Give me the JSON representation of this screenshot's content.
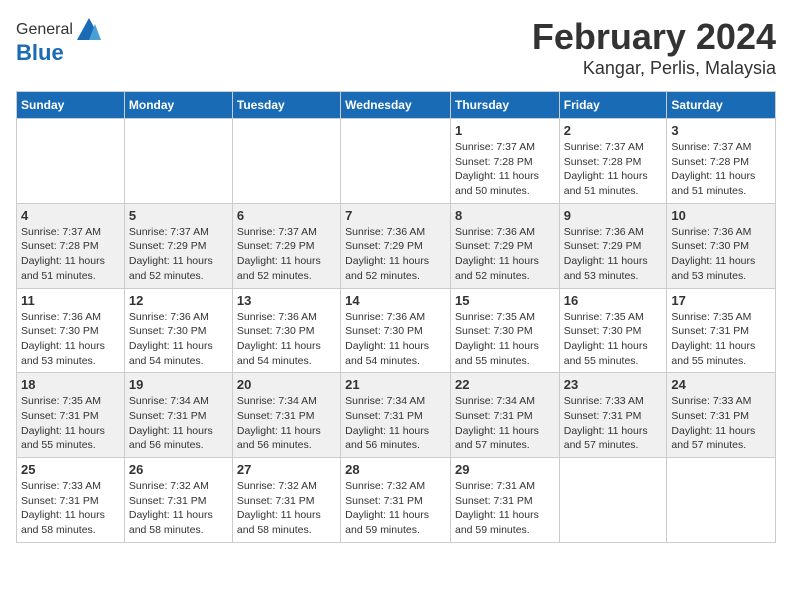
{
  "header": {
    "logo_general": "General",
    "logo_blue": "Blue",
    "month_title": "February 2024",
    "location": "Kangar, Perlis, Malaysia"
  },
  "weekdays": [
    "Sunday",
    "Monday",
    "Tuesday",
    "Wednesday",
    "Thursday",
    "Friday",
    "Saturday"
  ],
  "weeks": [
    [
      {
        "day": "",
        "info": ""
      },
      {
        "day": "",
        "info": ""
      },
      {
        "day": "",
        "info": ""
      },
      {
        "day": "",
        "info": ""
      },
      {
        "day": "1",
        "info": "Sunrise: 7:37 AM\nSunset: 7:28 PM\nDaylight: 11 hours\nand 50 minutes."
      },
      {
        "day": "2",
        "info": "Sunrise: 7:37 AM\nSunset: 7:28 PM\nDaylight: 11 hours\nand 51 minutes."
      },
      {
        "day": "3",
        "info": "Sunrise: 7:37 AM\nSunset: 7:28 PM\nDaylight: 11 hours\nand 51 minutes."
      }
    ],
    [
      {
        "day": "4",
        "info": "Sunrise: 7:37 AM\nSunset: 7:28 PM\nDaylight: 11 hours\nand 51 minutes."
      },
      {
        "day": "5",
        "info": "Sunrise: 7:37 AM\nSunset: 7:29 PM\nDaylight: 11 hours\nand 52 minutes."
      },
      {
        "day": "6",
        "info": "Sunrise: 7:37 AM\nSunset: 7:29 PM\nDaylight: 11 hours\nand 52 minutes."
      },
      {
        "day": "7",
        "info": "Sunrise: 7:36 AM\nSunset: 7:29 PM\nDaylight: 11 hours\nand 52 minutes."
      },
      {
        "day": "8",
        "info": "Sunrise: 7:36 AM\nSunset: 7:29 PM\nDaylight: 11 hours\nand 52 minutes."
      },
      {
        "day": "9",
        "info": "Sunrise: 7:36 AM\nSunset: 7:29 PM\nDaylight: 11 hours\nand 53 minutes."
      },
      {
        "day": "10",
        "info": "Sunrise: 7:36 AM\nSunset: 7:30 PM\nDaylight: 11 hours\nand 53 minutes."
      }
    ],
    [
      {
        "day": "11",
        "info": "Sunrise: 7:36 AM\nSunset: 7:30 PM\nDaylight: 11 hours\nand 53 minutes."
      },
      {
        "day": "12",
        "info": "Sunrise: 7:36 AM\nSunset: 7:30 PM\nDaylight: 11 hours\nand 54 minutes."
      },
      {
        "day": "13",
        "info": "Sunrise: 7:36 AM\nSunset: 7:30 PM\nDaylight: 11 hours\nand 54 minutes."
      },
      {
        "day": "14",
        "info": "Sunrise: 7:36 AM\nSunset: 7:30 PM\nDaylight: 11 hours\nand 54 minutes."
      },
      {
        "day": "15",
        "info": "Sunrise: 7:35 AM\nSunset: 7:30 PM\nDaylight: 11 hours\nand 55 minutes."
      },
      {
        "day": "16",
        "info": "Sunrise: 7:35 AM\nSunset: 7:30 PM\nDaylight: 11 hours\nand 55 minutes."
      },
      {
        "day": "17",
        "info": "Sunrise: 7:35 AM\nSunset: 7:31 PM\nDaylight: 11 hours\nand 55 minutes."
      }
    ],
    [
      {
        "day": "18",
        "info": "Sunrise: 7:35 AM\nSunset: 7:31 PM\nDaylight: 11 hours\nand 55 minutes."
      },
      {
        "day": "19",
        "info": "Sunrise: 7:34 AM\nSunset: 7:31 PM\nDaylight: 11 hours\nand 56 minutes."
      },
      {
        "day": "20",
        "info": "Sunrise: 7:34 AM\nSunset: 7:31 PM\nDaylight: 11 hours\nand 56 minutes."
      },
      {
        "day": "21",
        "info": "Sunrise: 7:34 AM\nSunset: 7:31 PM\nDaylight: 11 hours\nand 56 minutes."
      },
      {
        "day": "22",
        "info": "Sunrise: 7:34 AM\nSunset: 7:31 PM\nDaylight: 11 hours\nand 57 minutes."
      },
      {
        "day": "23",
        "info": "Sunrise: 7:33 AM\nSunset: 7:31 PM\nDaylight: 11 hours\nand 57 minutes."
      },
      {
        "day": "24",
        "info": "Sunrise: 7:33 AM\nSunset: 7:31 PM\nDaylight: 11 hours\nand 57 minutes."
      }
    ],
    [
      {
        "day": "25",
        "info": "Sunrise: 7:33 AM\nSunset: 7:31 PM\nDaylight: 11 hours\nand 58 minutes."
      },
      {
        "day": "26",
        "info": "Sunrise: 7:32 AM\nSunset: 7:31 PM\nDaylight: 11 hours\nand 58 minutes."
      },
      {
        "day": "27",
        "info": "Sunrise: 7:32 AM\nSunset: 7:31 PM\nDaylight: 11 hours\nand 58 minutes."
      },
      {
        "day": "28",
        "info": "Sunrise: 7:32 AM\nSunset: 7:31 PM\nDaylight: 11 hours\nand 59 minutes."
      },
      {
        "day": "29",
        "info": "Sunrise: 7:31 AM\nSunset: 7:31 PM\nDaylight: 11 hours\nand 59 minutes."
      },
      {
        "day": "",
        "info": ""
      },
      {
        "day": "",
        "info": ""
      }
    ]
  ]
}
